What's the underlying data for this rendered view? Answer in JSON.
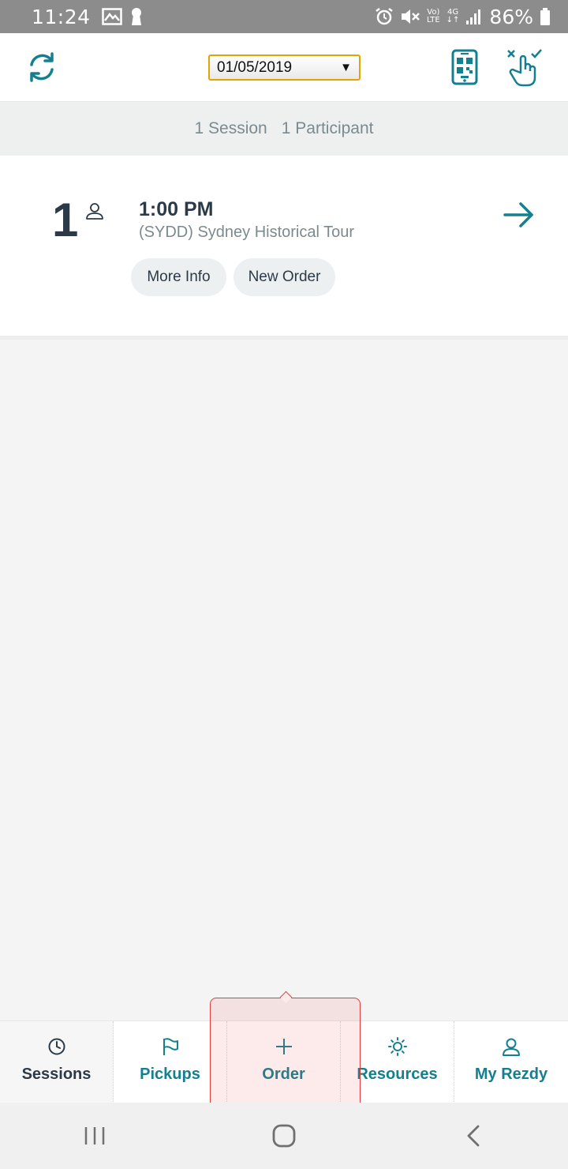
{
  "status_bar": {
    "time": "11:24",
    "battery_percent": "86%",
    "network_top": "Vo)",
    "network_bottom": "LTE",
    "gen_top": "4G",
    "gen_bottom": "↓↑"
  },
  "header": {
    "date_value": "01/05/2019",
    "date_caret": "▼"
  },
  "summary": {
    "sessions": "1 Session",
    "participants": "1 Participant"
  },
  "session": {
    "count": "1",
    "time": "1:00 PM",
    "name": "(SYDD) Sydney Historical Tour",
    "more_info_label": "More Info",
    "new_order_label": "New Order"
  },
  "tabs": [
    {
      "label": "Sessions",
      "icon": "clock-icon",
      "active": true
    },
    {
      "label": "Pickups",
      "icon": "flag-icon",
      "active": false
    },
    {
      "label": "Order",
      "icon": "plus-icon",
      "active": false
    },
    {
      "label": "Resources",
      "icon": "sun-icon",
      "active": false
    },
    {
      "label": "My Rezdy",
      "icon": "user-icon",
      "active": false
    }
  ],
  "colors": {
    "accent": "#14808f",
    "dark_text": "#2c3a47",
    "muted_text": "#7b8a8f",
    "highlight_border": "#e03c3c",
    "date_border": "#e0a500"
  }
}
